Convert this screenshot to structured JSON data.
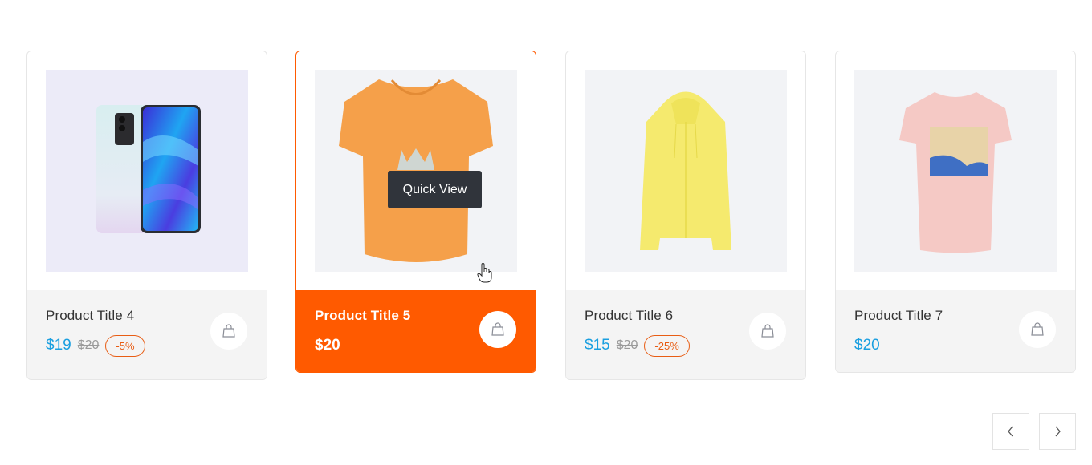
{
  "products": [
    {
      "title": "Product Title 4",
      "price": "$19",
      "old_price": "$20",
      "discount": "-5%",
      "image": "smartphone",
      "state": "default"
    },
    {
      "title": "Product Title 5",
      "price": "$20",
      "image": "orange-tshirt",
      "state": "hovered",
      "quick_view_label": "Quick View"
    },
    {
      "title": "Product Title 6",
      "price": "$15",
      "old_price": "$20",
      "discount": "-25%",
      "image": "yellow-hoodie",
      "state": "default"
    },
    {
      "title": "Product Title 7",
      "price": "$20",
      "image": "pink-tshirt",
      "state": "default"
    }
  ],
  "carousel": {
    "prev_icon": "chevron-left-icon",
    "next_icon": "chevron-right-icon"
  },
  "colors": {
    "accent": "#ff5a00",
    "price": "#1a9fe0",
    "discount": "#e85d14",
    "tooltip_bg": "#30343b"
  }
}
